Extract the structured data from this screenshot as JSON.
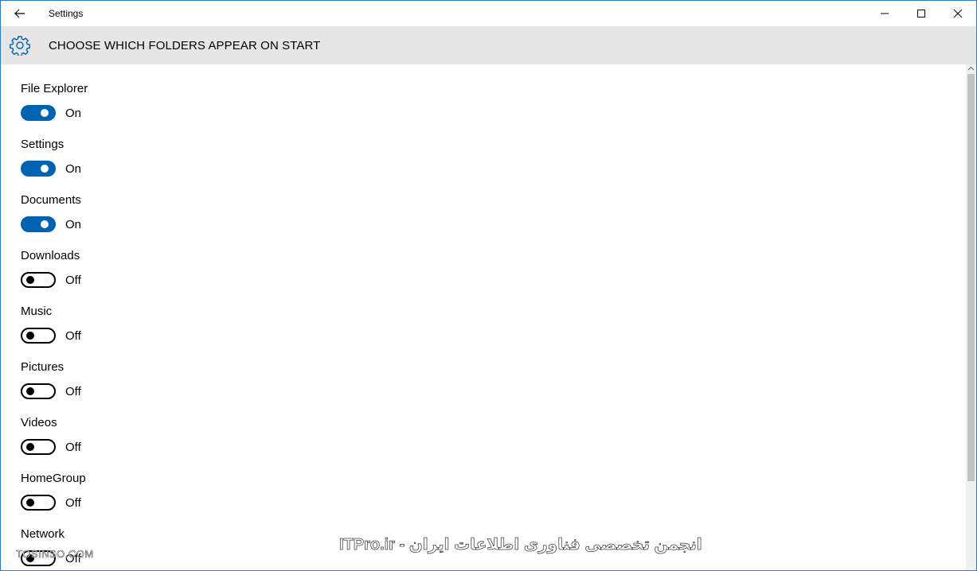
{
  "window": {
    "title": "Settings"
  },
  "header": {
    "title": "CHOOSE WHICH FOLDERS APPEAR ON START"
  },
  "settings": [
    {
      "label": "File Explorer",
      "state": "On",
      "on": true
    },
    {
      "label": "Settings",
      "state": "On",
      "on": true
    },
    {
      "label": "Documents",
      "state": "On",
      "on": true
    },
    {
      "label": "Downloads",
      "state": "Off",
      "on": false
    },
    {
      "label": "Music",
      "state": "Off",
      "on": false
    },
    {
      "label": "Pictures",
      "state": "Off",
      "on": false
    },
    {
      "label": "Videos",
      "state": "Off",
      "on": false
    },
    {
      "label": "HomeGroup",
      "state": "Off",
      "on": false
    },
    {
      "label": "Network",
      "state": "Off",
      "on": false
    }
  ],
  "watermarks": {
    "left": "TOSINSO.COM",
    "right": "ITPro.ir - انجمن تخصصی فناوری اطلاعات ایران"
  },
  "colors": {
    "accent": "#0063b1",
    "header_bg": "#e6e6e6",
    "window_border": "#2b7ad6"
  },
  "icons": {
    "back": "back-arrow-icon",
    "gear": "gear-icon",
    "minimize": "minimize-icon",
    "maximize": "maximize-icon",
    "close": "close-icon"
  }
}
